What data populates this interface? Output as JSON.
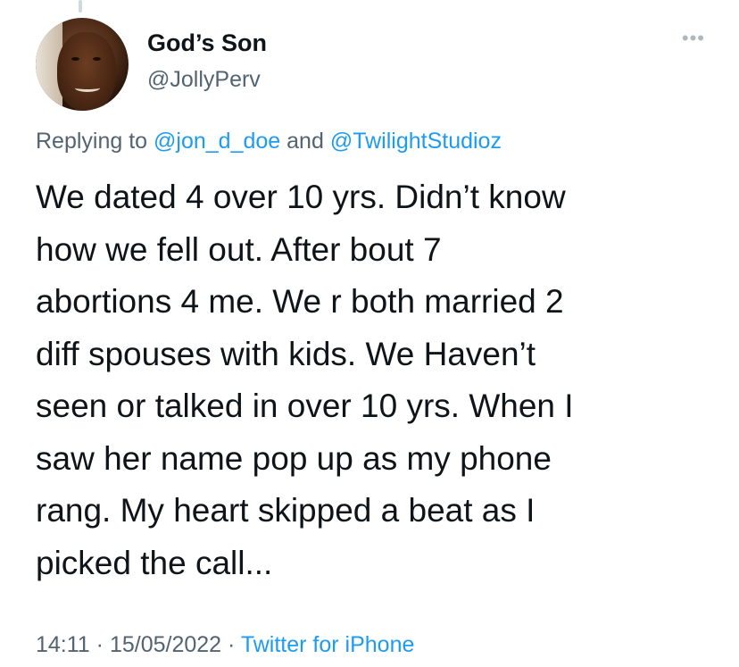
{
  "author": {
    "display_name": "God’s Son",
    "handle": "@JollyPerv"
  },
  "more_icon": "more-options-icon",
  "reply_context": {
    "prefix": "Replying to",
    "mention_1": "@jon_d_doe",
    "joiner": "and",
    "mention_2": "@TwilightStudioz"
  },
  "tweet": {
    "lines": [
      "We dated 4 over 10 yrs. Didn’t know",
      "how we fell out. After bout 7",
      "abortions 4 me. We r both married 2",
      "diff spouses with kids. We Haven’t",
      "seen or talked in over 10 yrs. When I",
      "saw her name pop up as my phone",
      "rang. My heart skipped a beat as I",
      "picked the call..."
    ]
  },
  "meta": {
    "time": "14:11",
    "separator": "·",
    "date": "15/05/2022",
    "source": "Twitter for iPhone"
  },
  "colors": {
    "link": "#1d9bf0",
    "secondary_text": "#536471",
    "primary_text": "#0f1419"
  }
}
